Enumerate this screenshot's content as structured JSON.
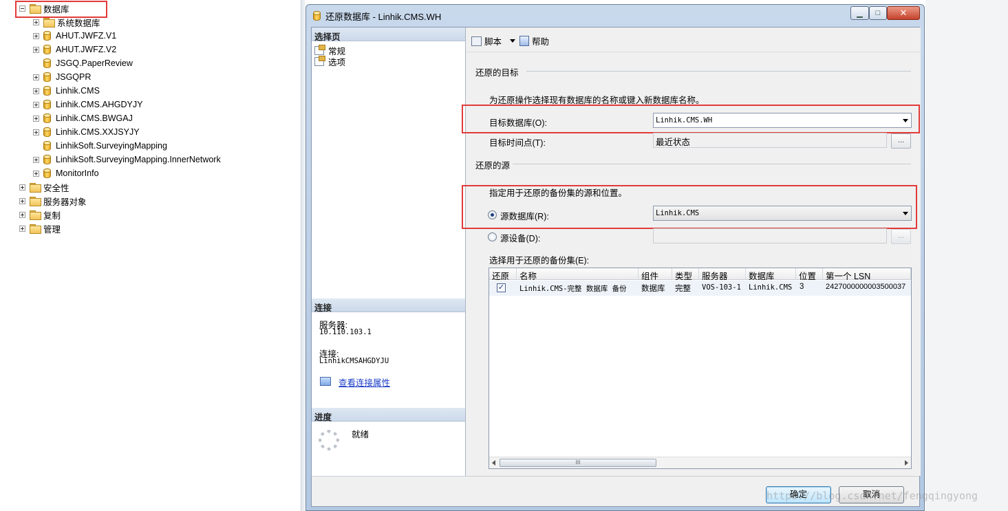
{
  "tree": {
    "root_label": "数据库",
    "items": [
      {
        "label": "系统数据库",
        "kind": "folder",
        "expander": "plus"
      },
      {
        "label": "AHUT.JWFZ.V1",
        "kind": "db",
        "expander": "plus"
      },
      {
        "label": "AHUT.JWFZ.V2",
        "kind": "db",
        "expander": "plus"
      },
      {
        "label": "JSGQ.PaperReview",
        "kind": "db",
        "expander": "none"
      },
      {
        "label": "JSGQPR",
        "kind": "db",
        "expander": "plus"
      },
      {
        "label": "Linhik.CMS",
        "kind": "db",
        "expander": "plus"
      },
      {
        "label": "Linhik.CMS.AHGDYJY",
        "kind": "db",
        "expander": "plus"
      },
      {
        "label": "Linhik.CMS.BWGAJ",
        "kind": "db",
        "expander": "plus"
      },
      {
        "label": "Linhik.CMS.XXJSYJY",
        "kind": "db",
        "expander": "plus"
      },
      {
        "label": "LinhikSoft.SurveyingMapping",
        "kind": "db",
        "expander": "none"
      },
      {
        "label": "LinhikSoft.SurveyingMapping.InnerNetwork",
        "kind": "db",
        "expander": "plus"
      },
      {
        "label": "MonitorInfo",
        "kind": "db",
        "expander": "plus"
      }
    ],
    "siblings": [
      "安全性",
      "服务器对象",
      "复制",
      "管理"
    ]
  },
  "dialog": {
    "title": "还原数据库 - Linhik.CMS.WH",
    "window_buttons": {
      "minimize": "▁",
      "maximize": "□",
      "close": "✕"
    },
    "select_page": {
      "header": "选择页",
      "items": [
        "常规",
        "选项"
      ]
    },
    "connection": {
      "header": "连接",
      "server_label": "服务器:",
      "server_value": "10.110.103.1",
      "conn_label": "连接:",
      "conn_value": "LinhikCMSAHGDYJU",
      "link": "查看连接属性"
    },
    "progress": {
      "header": "进度",
      "status": "就绪"
    },
    "toolbar": {
      "script": "脚本",
      "help": "帮助"
    },
    "destination": {
      "group": "还原的目标",
      "hint": "为还原操作选择现有数据库的名称或键入新数据库名称。",
      "target_db_label": "目标数据库(O):",
      "target_db_value": "Linhik.CMS.WH",
      "target_time_label": "目标时间点(T):",
      "target_time_value": "最近状态",
      "dots": "..."
    },
    "source": {
      "group": "还原的源",
      "hint": "指定用于还原的备份集的源和位置。",
      "source_db_label": "源数据库(R):",
      "source_db_value": "Linhik.CMS",
      "source_device_label": "源设备(D):",
      "dots": "..."
    },
    "backup_sets": {
      "label": "选择用于还原的备份集(E):",
      "columns": [
        "还原",
        "名称",
        "组件",
        "类型",
        "服务器",
        "数据库",
        "位置",
        "第一个 LSN"
      ],
      "rows": [
        {
          "restore": "✓",
          "name": "Linhik.CMS-完整 数据库 备份",
          "component": "数据库",
          "type": "完整",
          "server": "VOS-103-1",
          "database": "Linhik.CMS",
          "position": "3",
          "first_lsn": "2427000000003500037"
        }
      ],
      "scroll_grip": "III"
    },
    "buttons": {
      "ok": "确定",
      "cancel": "取消"
    }
  },
  "watermark": "https://blog.csdn.net/fengqingyong"
}
